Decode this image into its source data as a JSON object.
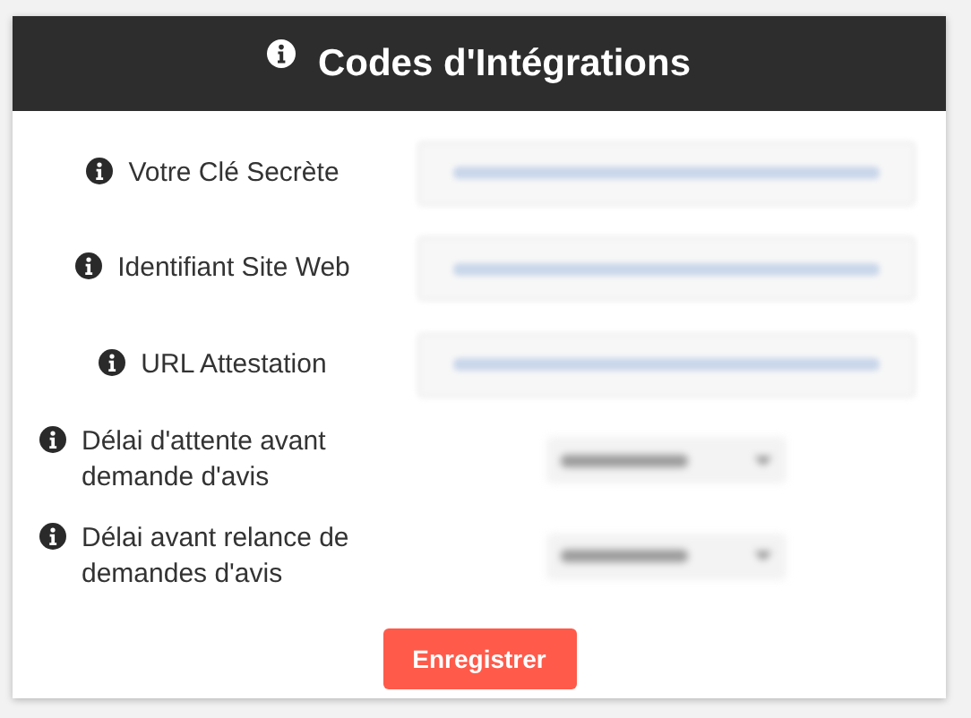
{
  "header": {
    "title": "Codes d'Intégrations"
  },
  "fields": [
    {
      "label": "Votre Clé Secrète",
      "kind": "text"
    },
    {
      "label": "Identifiant Site Web",
      "kind": "text"
    },
    {
      "label": "URL Attestation",
      "kind": "text"
    },
    {
      "label": "Délai d'attente avant demande d'avis",
      "kind": "select"
    },
    {
      "label": "Délai avant relance de demandes d'avis",
      "kind": "select"
    }
  ],
  "save_button": "Enregistrer"
}
